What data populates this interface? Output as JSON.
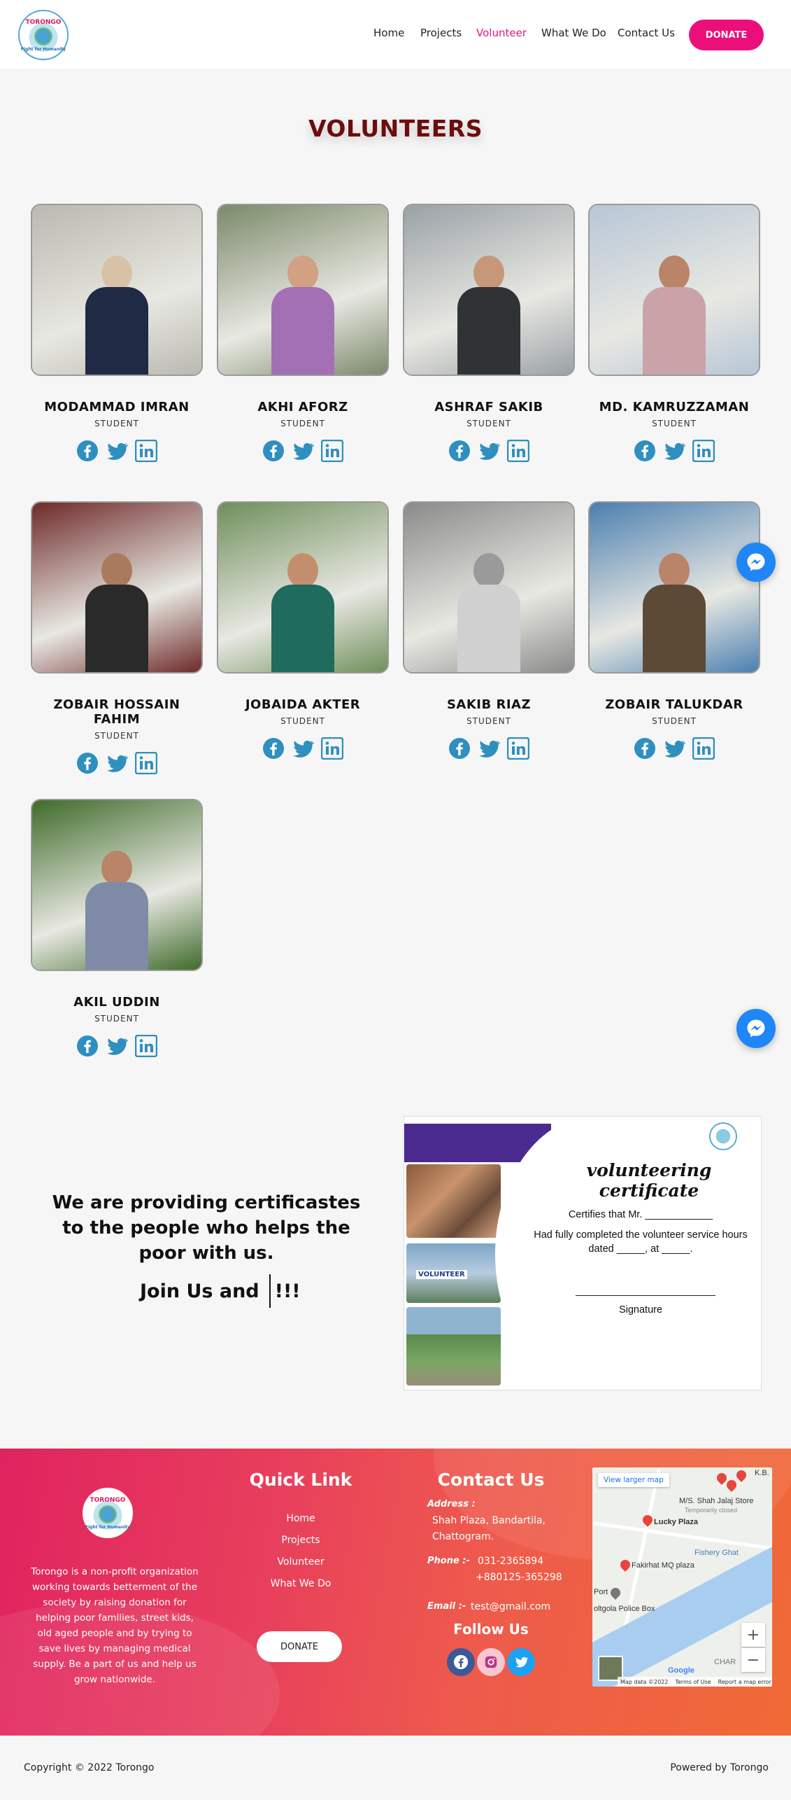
{
  "header": {
    "logo": {
      "top_text": "TORONGO",
      "bottom_text": "Fight for Humanity"
    },
    "nav": [
      {
        "label": "Home",
        "active": false
      },
      {
        "label": "Projects",
        "active": false
      },
      {
        "label": "Volunteer",
        "active": true
      },
      {
        "label": "What We Do",
        "active": false
      },
      {
        "label": "Contact Us",
        "active": false
      }
    ],
    "donate_label": "DONATE"
  },
  "volunteers": {
    "title": "VOLUNTEERS",
    "members": [
      {
        "name": "MODAMMAD IMRAN",
        "role": "STUDENT"
      },
      {
        "name": "AKHI AFORZ",
        "role": "STUDENT"
      },
      {
        "name": "ASHRAF SAKIB",
        "role": "STUDENT"
      },
      {
        "name": "MD. KAMRUZZAMAN",
        "role": "STUDENT"
      },
      {
        "name": "ZOBAIR HOSSAIN FAHIM",
        "role": "STUDENT"
      },
      {
        "name": "JOBAIDA AKTER",
        "role": "STUDENT"
      },
      {
        "name": "SAKIB RIAZ",
        "role": "STUDENT"
      },
      {
        "name": "ZOBAIR TALUKDAR",
        "role": "STUDENT"
      },
      {
        "name": "AKIL UDDIN",
        "role": "STUDENT"
      }
    ],
    "social_icons": [
      "facebook-icon",
      "twitter-icon",
      "linkedin-icon"
    ]
  },
  "certificate_section": {
    "text": "We are providing certificastes to the people who helps the poor with us.",
    "join_text": "Join Us and",
    "join_suffix": "!!!",
    "certificate": {
      "heading": "volunteering certificate",
      "line1": "Certifies that Mr. ____________",
      "line2": "Had fully completed the volunteer service hours",
      "line3": "dated _____, at _____.",
      "signature": "Signature",
      "photo_banner": "VOLUNTEER"
    }
  },
  "footer": {
    "about": "Torongo is a non-profit organization working towards betterment of the society by raising donation for helping poor families, street kids, old aged people and by trying to save lives by managing medical supply. Be a part of us and help us grow nationwide.",
    "quick_link_title": "Quick Link",
    "quick_links": [
      "Home",
      "Projects",
      "Volunteer",
      "What We Do"
    ],
    "donate_label": "DONATE",
    "contact_title": "Contact Us",
    "address_label": "Address :",
    "address_line1": "Shah Plaza, Bandartila,",
    "address_line2": "Chattogram.",
    "phone_label": "Phone :-",
    "phone1": "031-2365894",
    "phone2": "+880125-365298",
    "email_label": "Email :-",
    "email": "test@gmail.com",
    "follow_title": "Follow Us",
    "follow_icons": [
      "facebook-icon",
      "instagram-icon",
      "twitter-icon"
    ],
    "map": {
      "link_label": "View larger map",
      "labels": [
        "K.B.",
        "M/S. Shah Jalaj Store",
        "Temporarily closed",
        "Lucky Plaza",
        "Fishery Ghat",
        "Fakirhat MQ plaza",
        "Port",
        "oltgola Police Box",
        "CHAR"
      ],
      "footer_items": [
        "Map data ©2022",
        "Terms of Use",
        "Report a map error"
      ],
      "google": "Google"
    }
  },
  "bottom": {
    "copyright": "Copyright © 2022 Torongo",
    "powered": "Powered by Torongo"
  },
  "colors": {
    "accent": "#ec0e7b",
    "title": "#6b0d0d",
    "social": "#2f8fbf",
    "messenger": "#1f86f7"
  }
}
